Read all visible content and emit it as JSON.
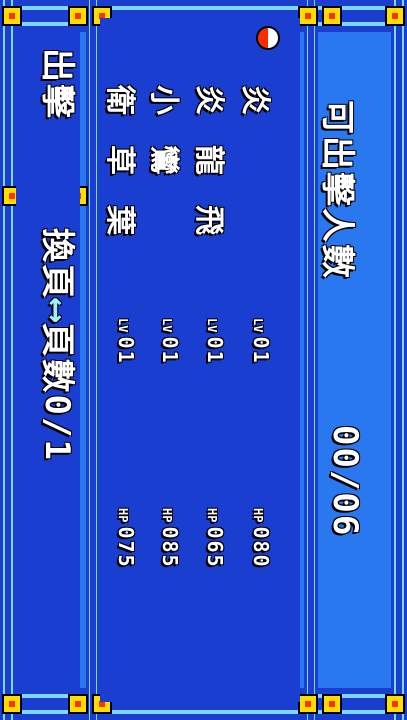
{
  "header": {
    "count_label": "可出擊人數",
    "count_value": "00/06"
  },
  "party": [
    {
      "name": "炎",
      "lv_key": "LV",
      "lv": "01",
      "hp_key": "HP",
      "hp": "080"
    },
    {
      "name": "炎 龍 飛",
      "lv_key": "LV",
      "lv": "01",
      "hp_key": "HP",
      "hp": "065"
    },
    {
      "name": "小   鸞",
      "lv_key": "LV",
      "lv": "01",
      "hp_key": "HP",
      "hp": "085"
    },
    {
      "name": "衛 草 葉",
      "lv_key": "LV",
      "lv": "01",
      "hp_key": "HP",
      "hp": "075"
    }
  ],
  "footer": {
    "sortie_label": "出擊",
    "swap_label": "換頁",
    "arrow_glyph": "⟷",
    "page_label": "頁數",
    "page_value": "0/1"
  },
  "colors": {
    "frame": "#2a78f0",
    "panel": "#1a3fd0",
    "stud": "#ffdd00",
    "text": "#ffffff"
  },
  "icons": {
    "cursor": "pokeball-icon",
    "frame_stud": "stud-icon"
  }
}
